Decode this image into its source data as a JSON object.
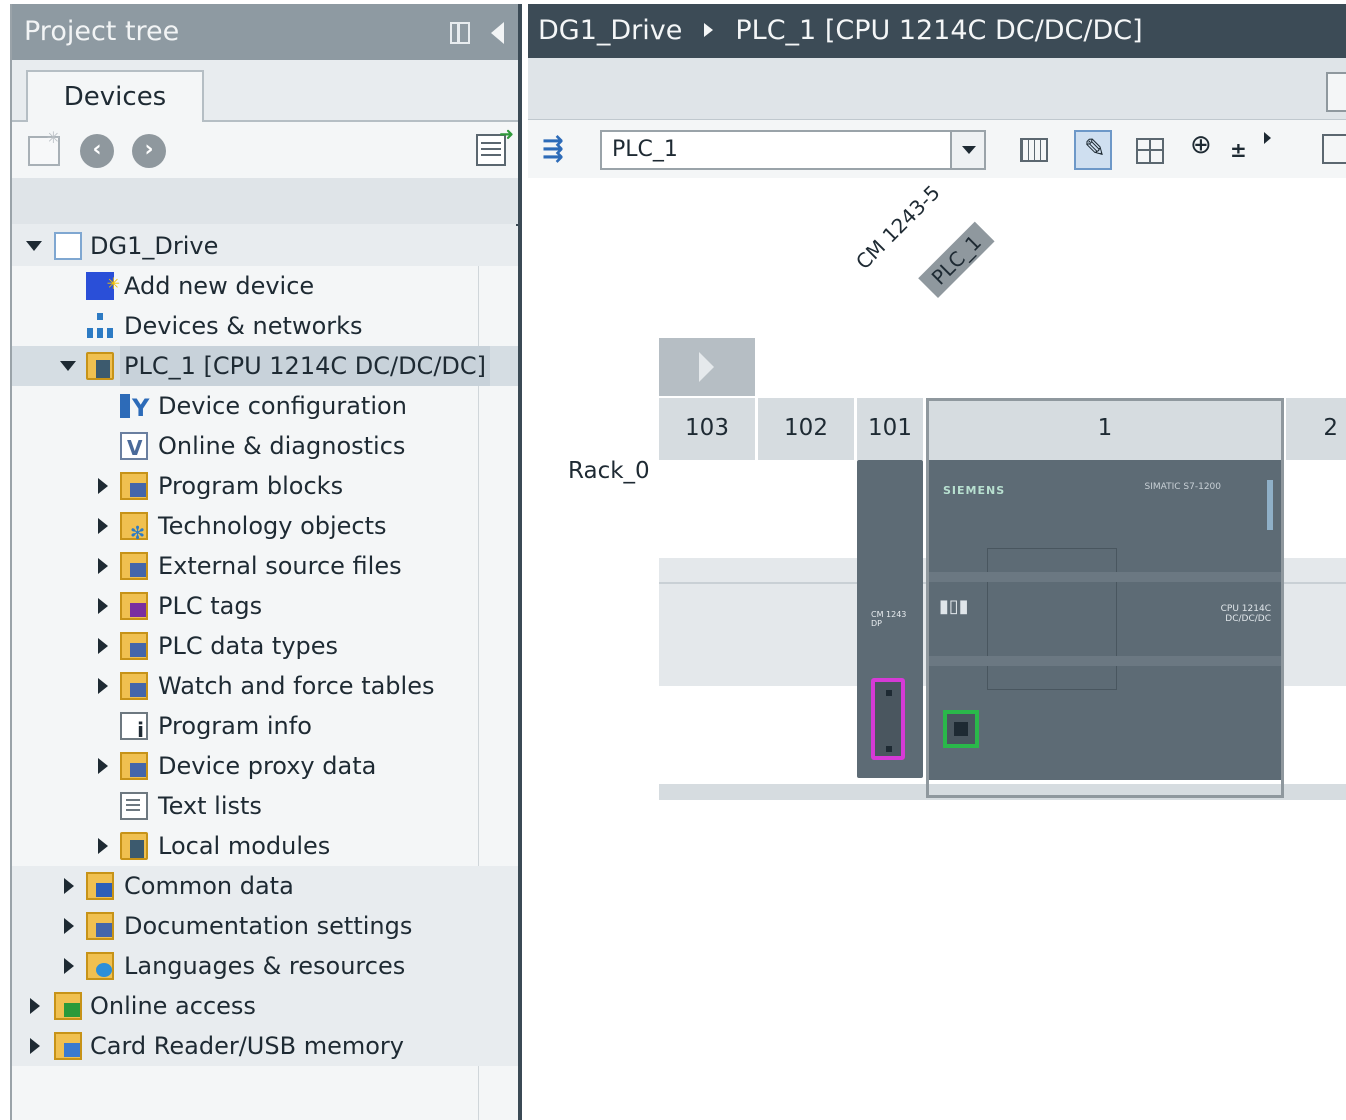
{
  "project_tree": {
    "title": "Project tree",
    "tab": "Devices",
    "items": [
      {
        "label": "DG1_Drive"
      },
      {
        "label": "Add new device"
      },
      {
        "label": "Devices & networks"
      },
      {
        "label": "PLC_1 [CPU 1214C DC/DC/DC]"
      },
      {
        "label": "Device configuration"
      },
      {
        "label": "Online & diagnostics"
      },
      {
        "label": "Program blocks"
      },
      {
        "label": "Technology objects"
      },
      {
        "label": "External source files"
      },
      {
        "label": "PLC tags"
      },
      {
        "label": "PLC data types"
      },
      {
        "label": "Watch and force tables"
      },
      {
        "label": "Program info"
      },
      {
        "label": "Device proxy data"
      },
      {
        "label": "Text lists"
      },
      {
        "label": "Local modules"
      },
      {
        "label": "Common data"
      },
      {
        "label": "Documentation settings"
      },
      {
        "label": "Languages & resources"
      },
      {
        "label": "Online access"
      },
      {
        "label": "Card Reader/USB memory"
      }
    ]
  },
  "editor": {
    "breadcrumb": [
      "DG1_Drive",
      "PLC_1 [CPU 1214C DC/DC/DC]"
    ],
    "device_select_value": "PLC_1",
    "module_labels": {
      "cm": "CM 1243-5",
      "plc": "PLC_1"
    },
    "rack_name": "Rack_0",
    "slots": [
      "103",
      "102",
      "101",
      "1",
      "2"
    ],
    "cpu": {
      "brand": "SIEMENS",
      "title": "SIMATIC S7-1200",
      "model": "CPU 1214C\nDC/DC/DC"
    },
    "cm_text": "CM 1243\nDP"
  },
  "colors": {
    "header_bg": "#8e9aa2",
    "breadcrumb_bg": "#3c4b56",
    "module_body": "#5d6b75",
    "profibus_port": "#d63ad6",
    "profinet_port": "#2ab84a"
  }
}
